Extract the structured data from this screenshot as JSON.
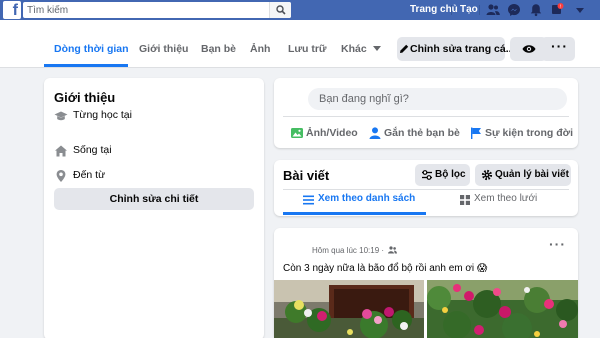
{
  "topbar": {
    "search_placeholder": "Tìm kiếm",
    "home_label": "Trang chủ",
    "create_label": "Tạo",
    "icons": [
      "facebook-logo",
      "search-icon",
      "friends-icon",
      "messenger-icon",
      "notifications-icon",
      "help-icon",
      "menu-caret-icon"
    ]
  },
  "profile_nav": {
    "tabs": [
      {
        "label": "Dòng thời gian",
        "active": true
      },
      {
        "label": "Giới thiệu"
      },
      {
        "label": "Bạn bè"
      },
      {
        "label": "Ảnh"
      },
      {
        "label": "Lưu trữ"
      },
      {
        "label": "Khác"
      }
    ],
    "edit_button": "Chỉnh sửa trang cá...",
    "view_as_icon": "eye-icon",
    "more_icon": "more-dots-icon"
  },
  "intro": {
    "title": "Giới thiệu",
    "items": [
      {
        "label": "Từng học tại",
        "icon": "graduation-cap-icon"
      },
      {
        "label": "Sống tại",
        "icon": "home-icon"
      },
      {
        "label": "Đến từ",
        "icon": "location-pin-icon"
      }
    ],
    "edit_details_button": "Chỉnh sửa chi tiết"
  },
  "composer": {
    "placeholder": "Bạn đang nghĩ gì?",
    "actions": [
      {
        "label": "Ảnh/Video",
        "icon": "photo-icon",
        "color": "#45bd62"
      },
      {
        "label": "Gắn thẻ bạn bè",
        "icon": "tag-friends-icon",
        "color": "#1877f2"
      },
      {
        "label": "Sự kiện trong đời",
        "icon": "flag-icon",
        "color": "#1877f2"
      }
    ]
  },
  "posts_header": {
    "title": "Bài viết",
    "filter_button": "Bộ lọc",
    "manage_button": "Quản lý bài viết",
    "list_view_tab": "Xem theo danh sách",
    "grid_view_tab": "Xem theo lưới"
  },
  "post": {
    "meta": "Hôm qua lúc 10:19 ·",
    "audience_icon": "friends-audience-icon",
    "text": "Còn 3 ngày nữa là bão đổ bộ rồi anh em ơi 😱",
    "images": [
      "flowers-on-table-photo",
      "garden-flowers-photo"
    ]
  },
  "colors": {
    "topbar": "#4267b2",
    "accent": "#1877f2",
    "background": "#f0f2f5",
    "button_gray": "#e4e6eb"
  }
}
